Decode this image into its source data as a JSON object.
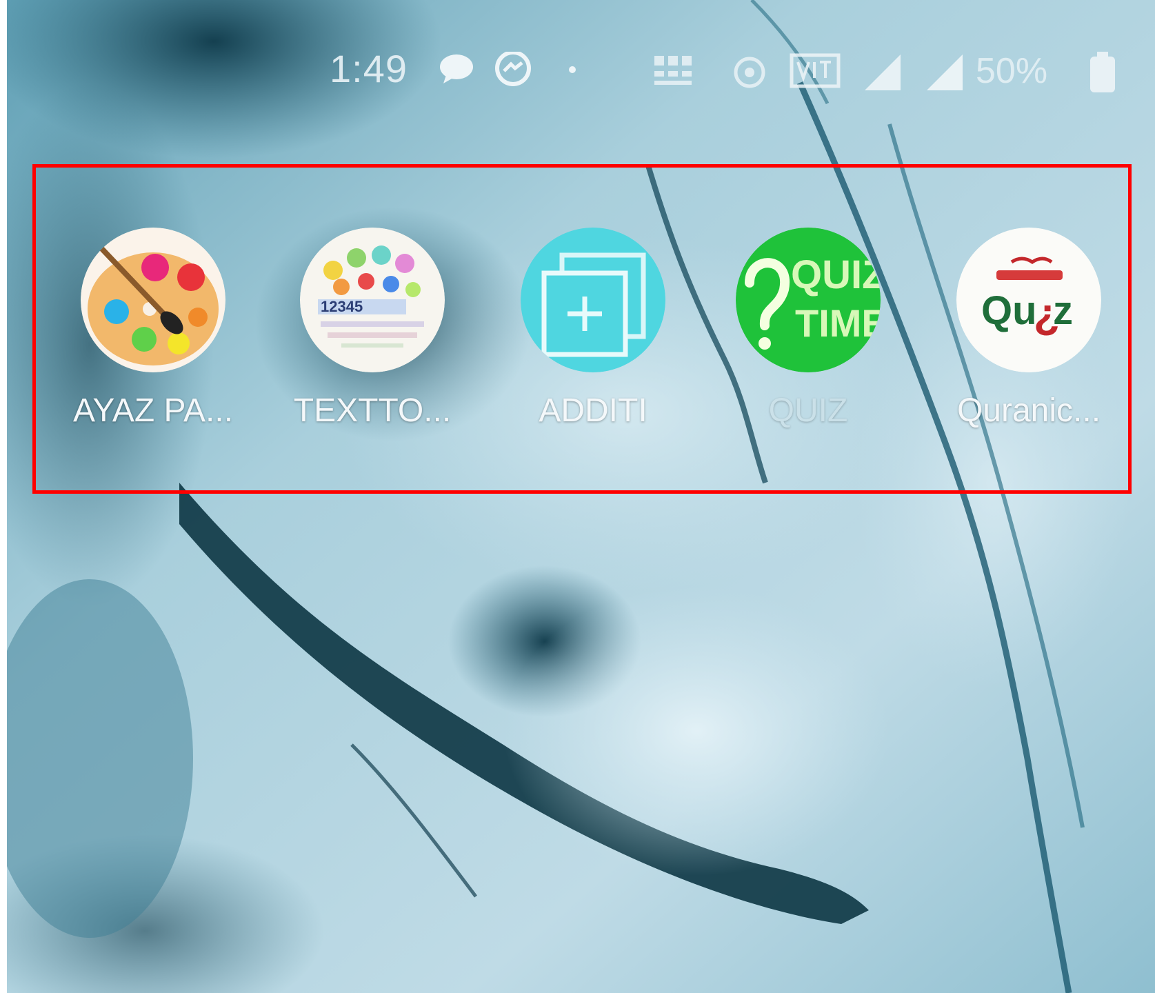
{
  "status_bar": {
    "time": "1:49",
    "battery": "50%",
    "icons": [
      "chat-bubble-icon",
      "messenger-icon",
      "dot-icon",
      "data-speed-icon",
      "location-icon",
      "volte-icon",
      "signal-icon",
      "signal-icon",
      "battery-icon"
    ]
  },
  "home_screen": {
    "apps": [
      {
        "label": "AYAZ PA...",
        "icon": "paint-palette-icon"
      },
      {
        "label": "TEXTTO...",
        "icon": "abc-123-collage-icon"
      },
      {
        "label": "ADDITI",
        "icon": "add-square-icon"
      },
      {
        "label": "QUIZ",
        "icon": "quiz-time-icon"
      },
      {
        "label": "Quranic...",
        "icon": "quranic-quiz-icon"
      }
    ]
  },
  "colors": {
    "highlight": "#ff0000",
    "wallpaper_base": "#9cc6d6",
    "add_icon": "#4fd6e0",
    "quiz_icon": "#1fc23a"
  }
}
